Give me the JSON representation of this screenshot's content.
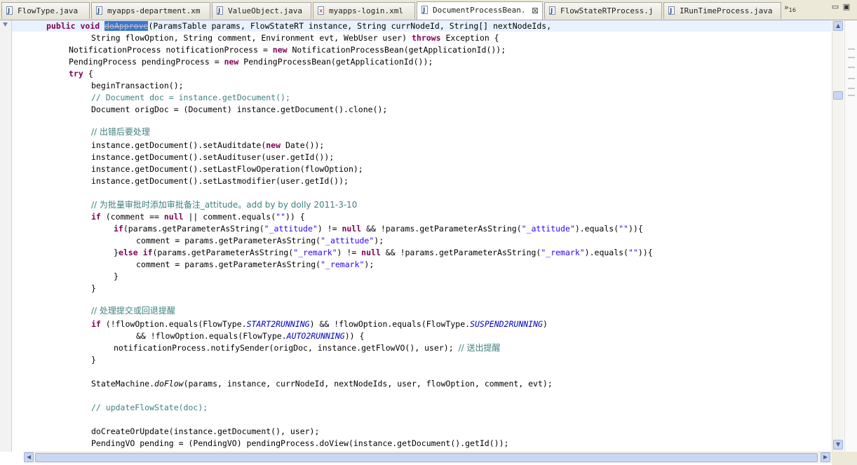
{
  "tabs": [
    {
      "label": "FlowType.java",
      "type": "java",
      "active": false
    },
    {
      "label": "myapps-department.xm",
      "type": "xml",
      "active": false
    },
    {
      "label": "ValueObject.java",
      "type": "java",
      "active": false
    },
    {
      "label": "myapps-login.xml",
      "type": "xml",
      "active": false
    },
    {
      "label": "DocumentProcessBean.",
      "type": "java",
      "active": true
    },
    {
      "label": "FlowStateRTProcess.j",
      "type": "java",
      "active": false
    },
    {
      "label": "IRunTimeProcess.java",
      "type": "java",
      "active": false
    }
  ],
  "tab_close_glyph": "⊠",
  "overflow_label": "»",
  "overflow_count": "16",
  "window_buttons": {
    "minimize": "▭",
    "maximize": "▣"
  },
  "code": {
    "l1": {
      "kw1": "public",
      "kw2": "void",
      "selected": "doApprove",
      "rest": "(ParamsTable params, FlowStateRT instance, String currNodeId, String[] nextNodeIds,"
    },
    "l2": {
      "a": "String flowOption, String comment, Environment evt, WebUser user) ",
      "kw": "throws",
      "b": " Exception {"
    },
    "l3": {
      "a": "NotificationProcess notificationProcess = ",
      "kw": "new",
      "b": " NotificationProcessBean(getApplicationId());"
    },
    "l4": {
      "a": "PendingProcess pendingProcess = ",
      "kw": "new",
      "b": " PendingProcessBean(getApplicationId());"
    },
    "l5": {
      "kw": "try",
      "b": " {"
    },
    "l6": "beginTransaction();",
    "l7": "// Document doc = instance.getDocument();",
    "l8": "Document origDoc = (Document) instance.getDocument().clone();",
    "l9": "// 出错后要处理",
    "l10": {
      "a": "instance.getDocument().setAuditdate(",
      "kw": "new",
      "b": " Date());"
    },
    "l11": "instance.getDocument().setAudituser(user.getId());",
    "l12": "instance.getDocument().setLastFlowOperation(flowOption);",
    "l13": "instance.getDocument().setLastmodifier(user.getId());",
    "l14": "// 为批量审批时添加审批备注_attitude。add by by dolly 2011-3-10",
    "l15": {
      "kw1": "if",
      "a": " (comment == ",
      "kw2": "null",
      "b": " || comment.equals(",
      "s": "\"\"",
      "c": ")) {"
    },
    "l16": {
      "kw1": "if",
      "a": "(params.getParameterAsString(",
      "s1": "\"_attitude\"",
      "b": ") != ",
      "kw2": "null",
      "c": " && !params.getParameterAsString(",
      "s2": "\"_attitude\"",
      "d": ").equals(",
      "s3": "\"\"",
      "e": ")){"
    },
    "l17": {
      "a": "comment = params.getParameterAsString(",
      "s": "\"_attitude\"",
      "b": ");"
    },
    "l18": {
      "a": "}",
      "kw1": "else",
      "sp": " ",
      "kw2": "if",
      "b": "(params.getParameterAsString(",
      "s1": "\"_remark\"",
      "c": ") != ",
      "kw3": "null",
      "d": " && !params.getParameterAsString(",
      "s2": "\"_remark\"",
      "e": ").equals(",
      "s3": "\"\"",
      "f": ")){"
    },
    "l19": {
      "a": "comment = params.getParameterAsString(",
      "s": "\"_remark\"",
      "b": ");"
    },
    "l20": "}",
    "l21": "}",
    "l22": "// 处理提交或回退提醒",
    "l23": {
      "kw": "if",
      "a": " (!flowOption.equals(FlowType.",
      "c1": "START2RUNNING",
      "b": ") && !flowOption.equals(FlowType.",
      "c2": "SUSPEND2RUNNING",
      "c": ")"
    },
    "l24": {
      "a": "&& !flowOption.equals(FlowType.",
      "c": "AUTO2RUNNING",
      "b": ")) {"
    },
    "l25": {
      "a": "notificationProcess.notifySender(origDoc, instance.getFlowVO(), user); ",
      "cm": "// 送出提醒"
    },
    "l26": "}",
    "l27": {
      "a": "StateMachine.",
      "m": "doFlow",
      "b": "(params, instance, currNodeId, nextNodeIds, user, flowOption, comment, evt);"
    },
    "l28": "// updateFlowState(doc);",
    "l29": "doCreateOrUpdate(instance.getDocument(), user);",
    "l30": "PendingVO pending = (PendingVO) pendingProcess.doView(instance.getDocument().getId());"
  },
  "scroll_arrows": {
    "up": "▲",
    "down": "▼",
    "left": "◀",
    "right": "▶"
  }
}
